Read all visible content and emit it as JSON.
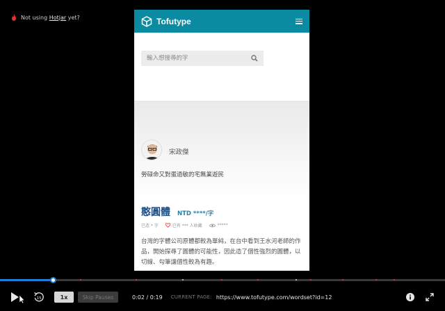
{
  "promo": {
    "text": "Not using ",
    "link": "Hotjar",
    "suffix": " yet?"
  },
  "site": {
    "brand": "Tofutype",
    "search_placeholder": "輸入想搜尋的字",
    "author": "宋政傑",
    "bio": "勞碌命又對蛋過敏的宅無業遊民",
    "font_name": "憨圓體",
    "price": "NTD ****/字",
    "meta_made": "已造 * 字",
    "meta_collected": "已有 *** 人收藏",
    "meta_views": "*****",
    "description": "台灣的字體公司原體都較為單純，在台中看到王水河老師的作品，開始探尋了圓體的可能性，因此造了個性強烈的圓體，以切線、勾筆讓個性較為有趣。"
  },
  "player": {
    "progress": 0.12,
    "speed": "1x",
    "skip_pauses": "Skip Pauses",
    "time": "0:02 / 0:19",
    "current_page_label": "CURRENT PAGE:",
    "current_page_url": "https://www.tofutype.com/wordset?id=12"
  },
  "colors": {
    "header": "#0a8ba1",
    "accent": "#1f7fd6",
    "event_marker": "#e0352b"
  },
  "icons": [
    "flame-icon",
    "cube-logo-icon",
    "hamburger-menu-icon",
    "search-icon",
    "heart-icon",
    "eye-icon",
    "play-icon",
    "rewind-icon",
    "info-icon",
    "fullscreen-icon",
    "cursor-icon"
  ]
}
